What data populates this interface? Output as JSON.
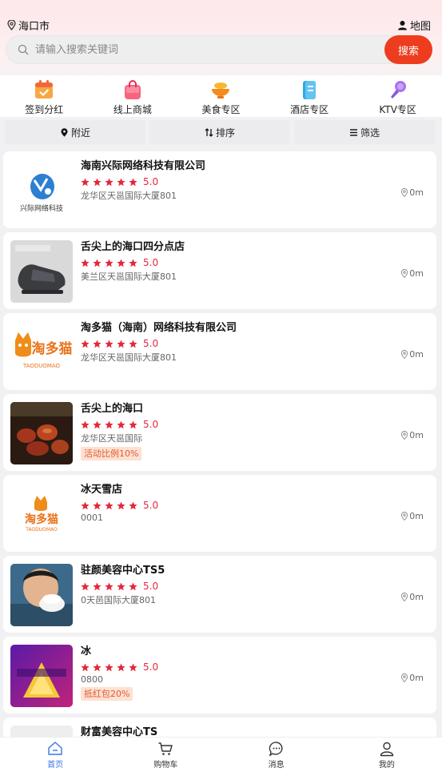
{
  "header": {
    "city": "海口市",
    "map_label": "地图"
  },
  "search": {
    "placeholder": "请输入搜索关键词",
    "button_label": "搜索"
  },
  "categories": [
    {
      "label": "签到分红",
      "icon": "calendar-icon"
    },
    {
      "label": "线上商城",
      "icon": "shopping-bag-icon"
    },
    {
      "label": "美食专区",
      "icon": "food-bowl-icon"
    },
    {
      "label": "酒店专区",
      "icon": "hotel-icon"
    },
    {
      "label": "KTV专区",
      "icon": "microphone-icon"
    }
  ],
  "filters": [
    {
      "label": "附近",
      "icon": "location-pin-icon"
    },
    {
      "label": "排序",
      "icon": "sort-icon"
    },
    {
      "label": "筛选",
      "icon": "menu-icon"
    }
  ],
  "shops": [
    {
      "name": "海南兴际网络科技有限公司",
      "score": "5.0",
      "stars": 5,
      "address": "龙华区天邕国际大厦801",
      "distance": "0m",
      "tag": "",
      "logo_text": "兴际网络科技"
    },
    {
      "name": "舌尖上的海口四分点店",
      "score": "5.0",
      "stars": 5,
      "address": "美兰区天邕国际大厦801",
      "distance": "0m",
      "tag": ""
    },
    {
      "name": "淘多猫（海南）网络科技有限公司",
      "score": "5.0",
      "stars": 5,
      "address": "龙华区天邕国际大厦801",
      "distance": "0m",
      "tag": "",
      "logo_text": "淘多猫",
      "logo_sub": "TAODUOMAO"
    },
    {
      "name": "舌尖上的海口",
      "score": "5.0",
      "stars": 5,
      "address": "龙华区天邕国际",
      "distance": "0m",
      "tag": "活动比例10%"
    },
    {
      "name": "冰天雪店",
      "score": "5.0",
      "stars": 5,
      "address": "0001",
      "distance": "0m",
      "tag": "",
      "logo_text": "淘多猫",
      "logo_sub": "TAODUOMAO"
    },
    {
      "name": "驻颜美容中心TS5",
      "score": "5.0",
      "stars": 5,
      "address": "0天邑国际大厦801",
      "distance": "0m",
      "tag": ""
    },
    {
      "name": "冰",
      "score": "5.0",
      "stars": 5,
      "address": "0800",
      "distance": "0m",
      "tag": "抵红包20%"
    },
    {
      "name": "财富美容中心TS",
      "score": "",
      "stars": 0,
      "address": "",
      "distance": "",
      "tag": ""
    }
  ],
  "tabbar": [
    {
      "label": "首页",
      "icon": "home-icon",
      "active": true
    },
    {
      "label": "购物车",
      "icon": "cart-icon",
      "active": false
    },
    {
      "label": "消息",
      "icon": "message-icon",
      "active": false
    },
    {
      "label": "我的",
      "icon": "user-icon",
      "active": false
    }
  ],
  "colors": {
    "accent": "#ee3c1e",
    "star": "#e4283a",
    "tab_active": "#3a74e8",
    "tag_bg": "#fde1d3",
    "tag_text": "#e35b2d"
  }
}
